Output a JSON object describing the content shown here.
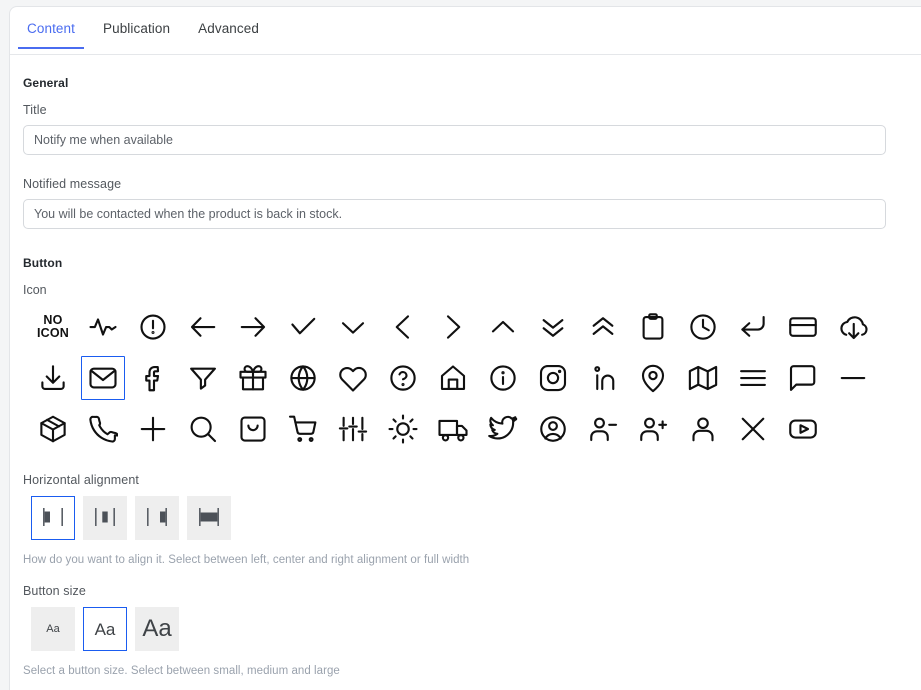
{
  "theme": {
    "accent": "#4a6cf0",
    "selected_border": "#1a5cf0",
    "panel_bg": "#ffffff",
    "page_bg": "#f4f5f6",
    "label_color": "#53585e",
    "helper_color": "#9aa2ad",
    "option_bg": "#eeeeee"
  },
  "tabs": [
    {
      "label": "Content",
      "active": true
    },
    {
      "label": "Publication",
      "active": false
    },
    {
      "label": "Advanced",
      "active": false
    }
  ],
  "general": {
    "section_title": "General",
    "title_label": "Title",
    "title_value": "Notify me when available",
    "title_placeholder": "Notify me when available",
    "message_label": "Notified message",
    "message_value": "You will be contacted when the product is back in stock.",
    "message_placeholder": "You will be contacted when the product is back in stock."
  },
  "button": {
    "section_title": "Button",
    "icon_label": "Icon",
    "no_icon_line1": "NO",
    "no_icon_line2": "ICON",
    "icons": [
      {
        "name": "no-icon",
        "selected": false
      },
      {
        "name": "activity-icon",
        "selected": false
      },
      {
        "name": "alert-circle-icon",
        "selected": false
      },
      {
        "name": "arrow-left-icon",
        "selected": false
      },
      {
        "name": "arrow-right-icon",
        "selected": false
      },
      {
        "name": "check-icon",
        "selected": false
      },
      {
        "name": "chevron-down-icon",
        "selected": false
      },
      {
        "name": "chevron-left-icon",
        "selected": false
      },
      {
        "name": "chevron-right-icon",
        "selected": false
      },
      {
        "name": "chevron-up-icon",
        "selected": false
      },
      {
        "name": "chevrons-down-icon",
        "selected": false
      },
      {
        "name": "chevrons-up-icon",
        "selected": false
      },
      {
        "name": "clipboard-icon",
        "selected": false
      },
      {
        "name": "clock-icon",
        "selected": false
      },
      {
        "name": "corner-down-left-icon",
        "selected": false
      },
      {
        "name": "credit-card-icon",
        "selected": false
      },
      {
        "name": "cloud-download-icon",
        "selected": false
      },
      {
        "name": "download-icon",
        "selected": false
      },
      {
        "name": "mail-icon",
        "selected": true
      },
      {
        "name": "facebook-icon",
        "selected": false
      },
      {
        "name": "filter-icon",
        "selected": false
      },
      {
        "name": "gift-icon",
        "selected": false
      },
      {
        "name": "globe-icon",
        "selected": false
      },
      {
        "name": "heart-icon",
        "selected": false
      },
      {
        "name": "help-circle-icon",
        "selected": false
      },
      {
        "name": "home-icon",
        "selected": false
      },
      {
        "name": "info-icon",
        "selected": false
      },
      {
        "name": "instagram-icon",
        "selected": false
      },
      {
        "name": "linkedin-icon",
        "selected": false
      },
      {
        "name": "map-pin-icon",
        "selected": false
      },
      {
        "name": "map-icon",
        "selected": false
      },
      {
        "name": "menu-icon",
        "selected": false
      },
      {
        "name": "message-square-icon",
        "selected": false
      },
      {
        "name": "minus-icon",
        "selected": false
      },
      {
        "name": "package-icon",
        "selected": false
      },
      {
        "name": "phone-icon",
        "selected": false
      },
      {
        "name": "plus-icon",
        "selected": false
      },
      {
        "name": "search-icon",
        "selected": false
      },
      {
        "name": "shopping-bag-icon",
        "selected": false
      },
      {
        "name": "shopping-cart-icon",
        "selected": false
      },
      {
        "name": "sliders-icon",
        "selected": false
      },
      {
        "name": "sun-icon",
        "selected": false
      },
      {
        "name": "truck-icon",
        "selected": false
      },
      {
        "name": "twitter-icon",
        "selected": false
      },
      {
        "name": "user-circle-icon",
        "selected": false
      },
      {
        "name": "user-minus-icon",
        "selected": false
      },
      {
        "name": "user-plus-icon",
        "selected": false
      },
      {
        "name": "user-icon",
        "selected": false
      },
      {
        "name": "x-icon",
        "selected": false
      },
      {
        "name": "youtube-icon",
        "selected": false
      }
    ]
  },
  "alignment": {
    "label": "Horizontal alignment",
    "helper": "How do you want to align it. Select between left, center and right alignment or full width",
    "options": [
      {
        "name": "align-left",
        "selected": true
      },
      {
        "name": "align-center",
        "selected": false
      },
      {
        "name": "align-right",
        "selected": false
      },
      {
        "name": "align-full-width",
        "selected": false
      }
    ]
  },
  "button_size": {
    "label": "Button size",
    "helper": "Select a button size. Select between small, medium and large",
    "options": [
      {
        "name": "size-small",
        "text": "Aa",
        "selected": false
      },
      {
        "name": "size-medium",
        "text": "Aa",
        "selected": true
      },
      {
        "name": "size-large",
        "text": "Aa",
        "selected": false
      }
    ]
  }
}
